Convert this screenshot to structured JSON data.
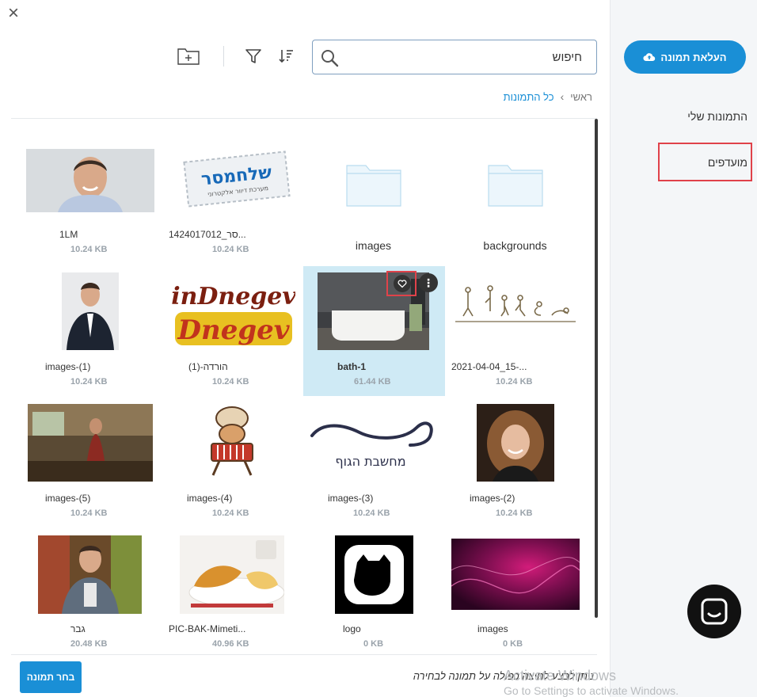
{
  "close_label": "×",
  "sidebar": {
    "upload_label": "העלאת תמונה",
    "items": [
      {
        "label": "התמונות שלי"
      },
      {
        "label": "מועדפים"
      }
    ]
  },
  "toolbar": {
    "search_placeholder": "חיפוש"
  },
  "breadcrumb": {
    "home": "ראשי",
    "separator": "›",
    "current": "כל התמונות"
  },
  "items": [
    {
      "name": "1LM",
      "size": "10.24 KB"
    },
    {
      "name": "1424017012_סר...",
      "size": "10.24 KB"
    },
    {
      "name": "images"
    },
    {
      "name": "backgrounds"
    },
    {
      "name": "images-(1)",
      "size": "10.24 KB"
    },
    {
      "name": "הורדה-(1)",
      "size": "10.24 KB"
    },
    {
      "name": "bath-1",
      "size": "61.44 KB",
      "selected": true
    },
    {
      "name": "2021-04-04_15-...",
      "size": "10.24 KB"
    },
    {
      "name": "images-(5)",
      "size": "10.24 KB"
    },
    {
      "name": "images-(4)",
      "size": "10.24 KB"
    },
    {
      "name": "images-(3)",
      "size": "10.24 KB"
    },
    {
      "name": "images-(2)",
      "size": "10.24 KB"
    },
    {
      "name": "גבר",
      "size": "20.48 KB"
    },
    {
      "name": "PIC-BAK-Mimeti...",
      "size": "40.96 KB"
    },
    {
      "name": "logo",
      "size": "0 KB"
    },
    {
      "name": "images",
      "size": "0 KB"
    }
  ],
  "thumb_text": {
    "shlach_main": "שלחמסר",
    "shlach_sub": "מערכת דיוור אלקטרוני",
    "indnegev_1": "inDnegev",
    "indnegev_2": "Dnegev",
    "body_logo": "מחשבת הגוף"
  },
  "more_label": "⋮",
  "footer": {
    "choose_label": "בחר תמונה",
    "hint": "ניתן לבצע לחיצה כפולה על תמונה לבחירה"
  },
  "watermark": {
    "line1": "Activate Windows",
    "line2": "Go to Settings to activate Windows."
  },
  "colors": {
    "accent": "#1a8fd6",
    "selected_bg": "#cfeaf5",
    "highlight_border": "#e0424a",
    "sidebar_bg": "#f4f6f8"
  }
}
